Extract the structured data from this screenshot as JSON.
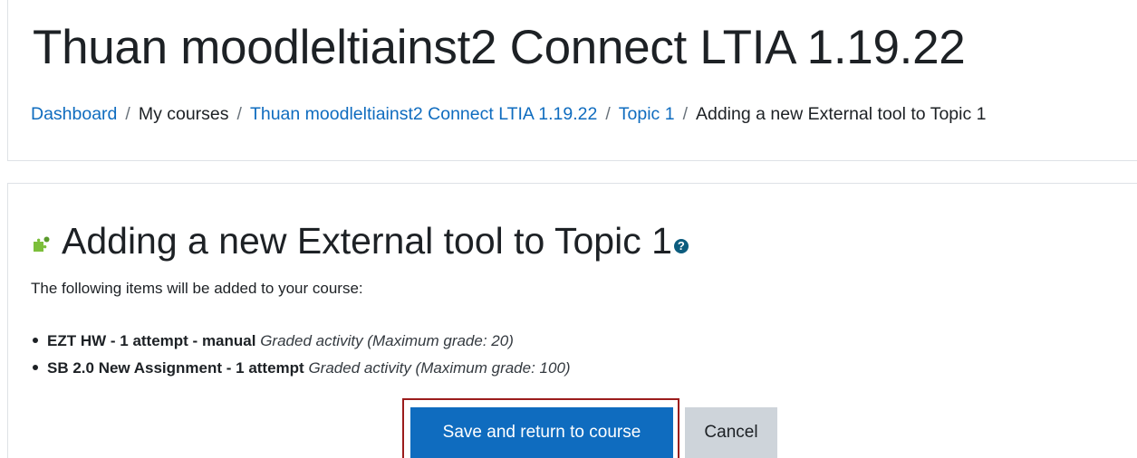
{
  "course": {
    "title": "Thuan moodleltiainst2 Connect LTIA 1.19.22"
  },
  "breadcrumb": [
    {
      "label": "Dashboard",
      "link": true
    },
    {
      "label": "My courses",
      "link": false
    },
    {
      "label": "Thuan moodleltiainst2 Connect LTIA 1.19.22",
      "link": true
    },
    {
      "label": "Topic 1",
      "link": true
    },
    {
      "label": "Adding a new External tool to Topic 1",
      "link": false
    }
  ],
  "breadcrumb_separator": "/",
  "page": {
    "heading": "Adding a new External tool to Topic 1",
    "help_icon_glyph": "?",
    "intro": "The following items will be added to your course:",
    "items": [
      {
        "name": "EZT HW - 1 attempt - manual",
        "detail": "Graded activity (Maximum grade: 20)"
      },
      {
        "name": "SB 2.0 New Assignment - 1 attempt",
        "detail": "Graded activity (Maximum grade: 100)"
      }
    ]
  },
  "actions": {
    "save_label": "Save and return to course",
    "cancel_label": "Cancel"
  },
  "colors": {
    "link": "#0f6cbf",
    "primary_button": "#0f6cbf",
    "secondary_button": "#ced4da",
    "focus_frame": "#9b1c1c",
    "help_icon": "#0c5c7e",
    "puzzle_icon": "#7cbf3b"
  }
}
